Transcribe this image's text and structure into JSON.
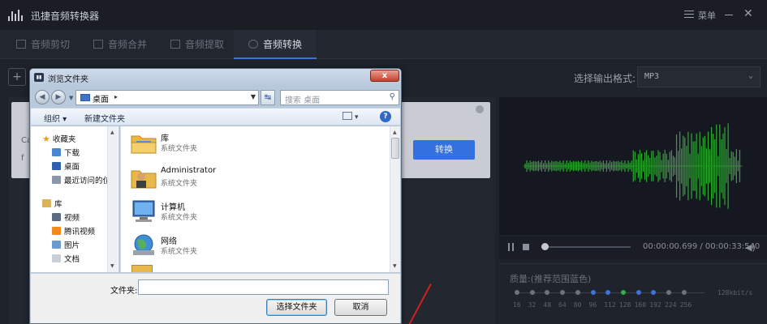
{
  "app": {
    "title": "迅捷音频转换器",
    "menu_label": "菜单",
    "tabs": [
      {
        "label": "音频剪切",
        "active": false
      },
      {
        "label": "音频合并",
        "active": false
      },
      {
        "label": "音频提取",
        "active": false
      },
      {
        "label": "音频转换",
        "active": true
      }
    ],
    "add_label": "+",
    "format_label": "选择输出格式:",
    "format_value": "MP3",
    "convert_label": "转换",
    "file_line1": "Ca",
    "file_line2": "f",
    "player": {
      "time": "00:00:00.699 / 00:00:33:540",
      "progress": 0.02
    },
    "quality": {
      "label": "质量:(推荐范围蓝色)",
      "values": [
        "16",
        "32",
        "48",
        "64",
        "80",
        "96",
        "112",
        "128",
        "160",
        "192",
        "224",
        "256"
      ],
      "unit": "128kbit/s",
      "selected": "128"
    },
    "accent_color": "#3b73d9"
  },
  "dialog": {
    "title": "浏览文件夹",
    "close_label": "x",
    "address": "桌面",
    "search_placeholder": "搜索 桌面",
    "organize_label": "组织",
    "new_folder_label": "新建文件夹",
    "tree": [
      {
        "label": "收藏夹",
        "icon": "star-icon",
        "level": 0
      },
      {
        "label": "下载",
        "icon": "download-folder-icon",
        "level": 1
      },
      {
        "label": "桌面",
        "icon": "desktop-icon",
        "level": 1
      },
      {
        "label": "最近访问的位",
        "icon": "recent-icon",
        "level": 1
      },
      {
        "label": "库",
        "icon": "library-icon",
        "level": 0
      },
      {
        "label": "视频",
        "icon": "video-icon",
        "level": 1
      },
      {
        "label": "腾讯视频",
        "icon": "tencent-video-icon",
        "level": 1
      },
      {
        "label": "图片",
        "icon": "picture-icon",
        "level": 1
      },
      {
        "label": "文档",
        "icon": "document-icon",
        "level": 1
      }
    ],
    "entries": [
      {
        "name": "库",
        "sub": "系统文件夹",
        "icon": "library-folder-icon"
      },
      {
        "name": "Administrator",
        "sub": "系统文件夹",
        "icon": "user-folder-icon"
      },
      {
        "name": "计算机",
        "sub": "系统文件夹",
        "icon": "computer-icon"
      },
      {
        "name": "网络",
        "sub": "系统文件夹",
        "icon": "network-icon"
      }
    ],
    "folder_label": "文件夹:",
    "folder_value": "",
    "select_label": "选择文件夹",
    "cancel_label": "取消"
  }
}
